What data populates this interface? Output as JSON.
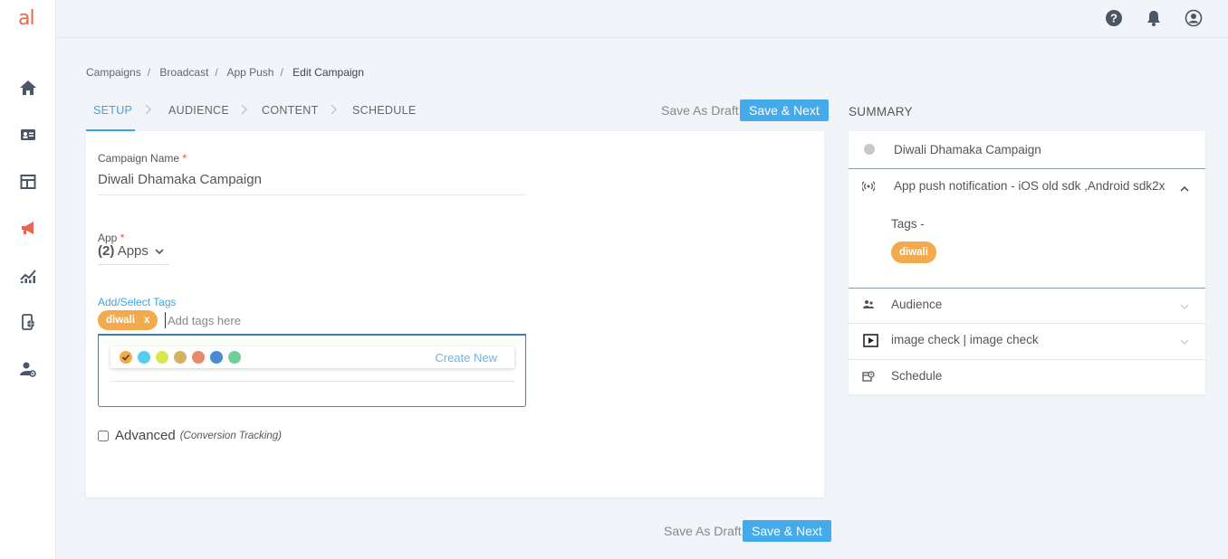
{
  "logo": "al",
  "colors": {
    "accent": "#3da4e0",
    "primary_button": "#45aaea",
    "tag": "#f2aa4c",
    "active_nav": "#e9664f"
  },
  "nav": {
    "items": [
      {
        "name": "home-icon"
      },
      {
        "name": "contact-card-icon"
      },
      {
        "name": "layout-icon"
      },
      {
        "name": "megaphone-icon"
      },
      {
        "name": "analytics-icon"
      },
      {
        "name": "mobile-globe-icon"
      },
      {
        "name": "user-settings-icon"
      }
    ]
  },
  "breadcrumb": [
    "Campaigns",
    "Broadcast",
    "App Push",
    "Edit Campaign"
  ],
  "steps": [
    "SETUP",
    "AUDIENCE",
    "CONTENT",
    "SCHEDULE"
  ],
  "actions": {
    "draft": "Save As Draft",
    "next": "Save & Next"
  },
  "form": {
    "campaign_label": "Campaign Name",
    "required_mark": "*",
    "campaign_value": "Diwali Dhamaka Campaign",
    "app_label": "App",
    "app_count": "(2)",
    "app_value": "Apps",
    "tags_label": "Add/Select Tags",
    "tag_chip": "diwali",
    "tag_remove": "x",
    "tags_placeholder": "Add tags here",
    "swatches": [
      "#f2aa4c",
      "#55cdf0",
      "#d8e84a",
      "#d2b460",
      "#e7896a",
      "#4a8ad4",
      "#6fcf97"
    ],
    "create_new": "Create New",
    "advanced_label": "Advanced",
    "advanced_note": "(Conversion Tracking)"
  },
  "summary": {
    "title": "SUMMARY",
    "campaign": "Diwali Dhamaka Campaign",
    "channel": "App push notification - iOS old sdk ,Android sdk2x",
    "tags_label": "Tags -",
    "tag": "diwali",
    "audience": "Audience",
    "content": "image check | image check",
    "schedule": "Schedule"
  }
}
